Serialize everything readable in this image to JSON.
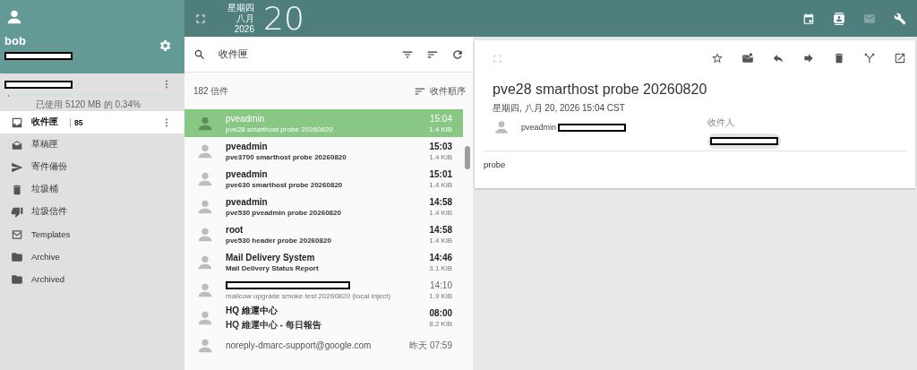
{
  "sidebar": {
    "user": {
      "name": "bob"
    },
    "account": {
      "usage": "已使用 5120 MB 的 0.34%",
      "level": 0.0034
    },
    "folders": [
      {
        "kind": "inbox",
        "label": "收件匣",
        "count": "85",
        "selected": true
      },
      {
        "kind": "drafts",
        "label": "草稿匣",
        "selected": false
      },
      {
        "kind": "sent",
        "label": "寄件備份",
        "selected": false
      },
      {
        "kind": "trash",
        "label": "垃圾桶",
        "selected": false
      },
      {
        "kind": "junk",
        "label": "垃圾信件",
        "selected": false
      },
      {
        "kind": "templates",
        "label": "Templates",
        "selected": false
      },
      {
        "kind": "folder",
        "label": "Archive",
        "selected": false
      },
      {
        "kind": "folder",
        "label": "Archived",
        "selected": false
      }
    ]
  },
  "topbar": {
    "weekday": "星期四",
    "month": "八月",
    "year": "2026",
    "day": "20",
    "apps": [
      {
        "kind": "calendar",
        "disabled": false
      },
      {
        "kind": "contacts",
        "disabled": false
      },
      {
        "kind": "mail",
        "disabled": true
      },
      {
        "kind": "settings",
        "disabled": false
      }
    ]
  },
  "list": {
    "title": "收件匣",
    "count": "182 信件",
    "sort": "收件順序",
    "messages": [
      {
        "sender": "pveadmin",
        "subject": "pve28 smarthost probe 20260820",
        "time": "15:04",
        "size": "1.4 KiB",
        "selected": true,
        "unread": false
      },
      {
        "sender": "pveadmin",
        "subject": "pve3700 smarthost probe 20260820",
        "time": "15:03",
        "size": "1.4 KiB",
        "selected": false,
        "unread": true
      },
      {
        "sender": "pveadmin",
        "subject": "pve630 smarthost probe 20260820",
        "time": "15:01",
        "size": "1.4 KiB",
        "selected": false,
        "unread": true
      },
      {
        "sender": "pveadmin",
        "subject": "pve530 pveadmin probe 20260820",
        "time": "14:58",
        "size": "1.4 KiB",
        "selected": false,
        "unread": true
      },
      {
        "sender": "root",
        "subject": "pve530 header probe 20260820",
        "time": "14:58",
        "size": "1.4 KiB",
        "selected": false,
        "unread": true
      },
      {
        "sender": "Mail Delivery System",
        "subject": "Mail Delivery Status Report",
        "time": "14:46",
        "size": "3.1 KiB",
        "selected": false,
        "unread": true
      },
      {
        "subject": "mailcow upgrade smoke test 20260820 (local inject)",
        "time": "14:10",
        "size": "1.9 KiB",
        "selected": false,
        "unread": false
      },
      {
        "sender": "HQ 維運中心",
        "subject": "HQ 維運中心 - 每日報告",
        "time": "08:00",
        "size": "8.2 KiB",
        "selected": false,
        "unread": true
      },
      {
        "sender": "noreply-dmarc-support@google.com",
        "time": "昨天 07:59",
        "selected": false,
        "unread": false
      }
    ]
  },
  "reader": {
    "subject": "pve28 smarthost probe 20260820",
    "date": "星期四, 八月 20, 2026 15:04 CST",
    "sender": "pveadmin",
    "to_label": "收件人",
    "body": "probe"
  }
}
